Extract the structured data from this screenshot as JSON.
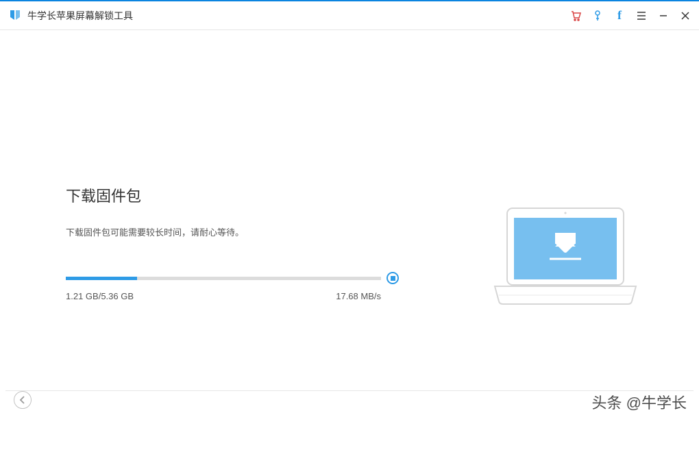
{
  "header": {
    "app_title": "牛学长苹果屏幕解锁工具"
  },
  "main": {
    "heading": "下载固件包",
    "subtext": "下载固件包可能需要较长时间，请耐心等待。",
    "progress": {
      "downloaded": "1.21 GB",
      "total": "5.36 GB",
      "separator": "/",
      "speed": "17.68 MB/s",
      "percent": 22.5
    }
  },
  "watermark": "头条 @牛学长",
  "colors": {
    "primary": "#2e9be6",
    "accent_red": "#d94444",
    "screen_blue": "#77bfef"
  }
}
